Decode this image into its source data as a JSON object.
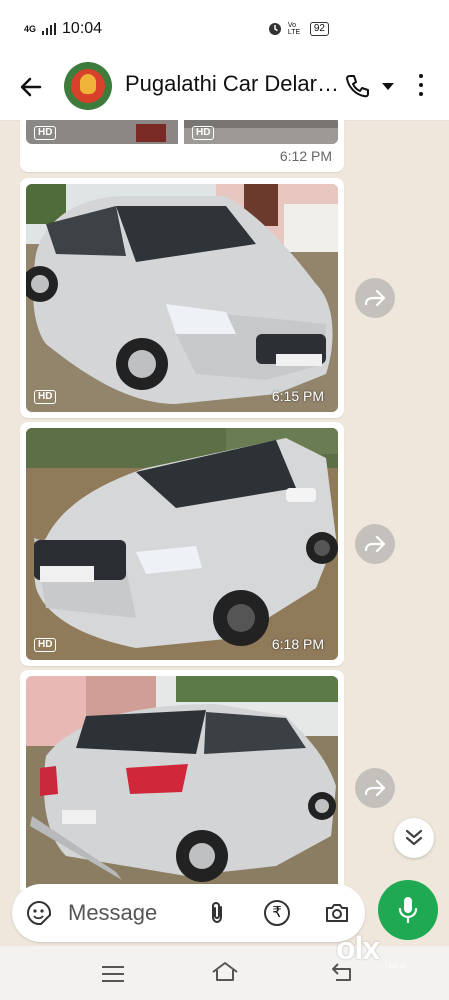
{
  "status": {
    "time": "10:04",
    "network": "4G",
    "vo_lte": "Vo LTE",
    "battery": "92"
  },
  "header": {
    "title": "Pugalathi Car Delar…"
  },
  "messages": [
    {
      "time": "6:12 PM",
      "hd": "HD"
    },
    {
      "time": "6:15 PM",
      "hd": "HD"
    },
    {
      "time": "6:18 PM",
      "hd": "HD"
    }
  ],
  "composer": {
    "placeholder": "Message",
    "rupee": "₹"
  },
  "watermark": {
    "text": "olx",
    "sub": "INDIA"
  },
  "colors": {
    "accent": "#1ea952",
    "chat_bg": "#efe7dc"
  }
}
